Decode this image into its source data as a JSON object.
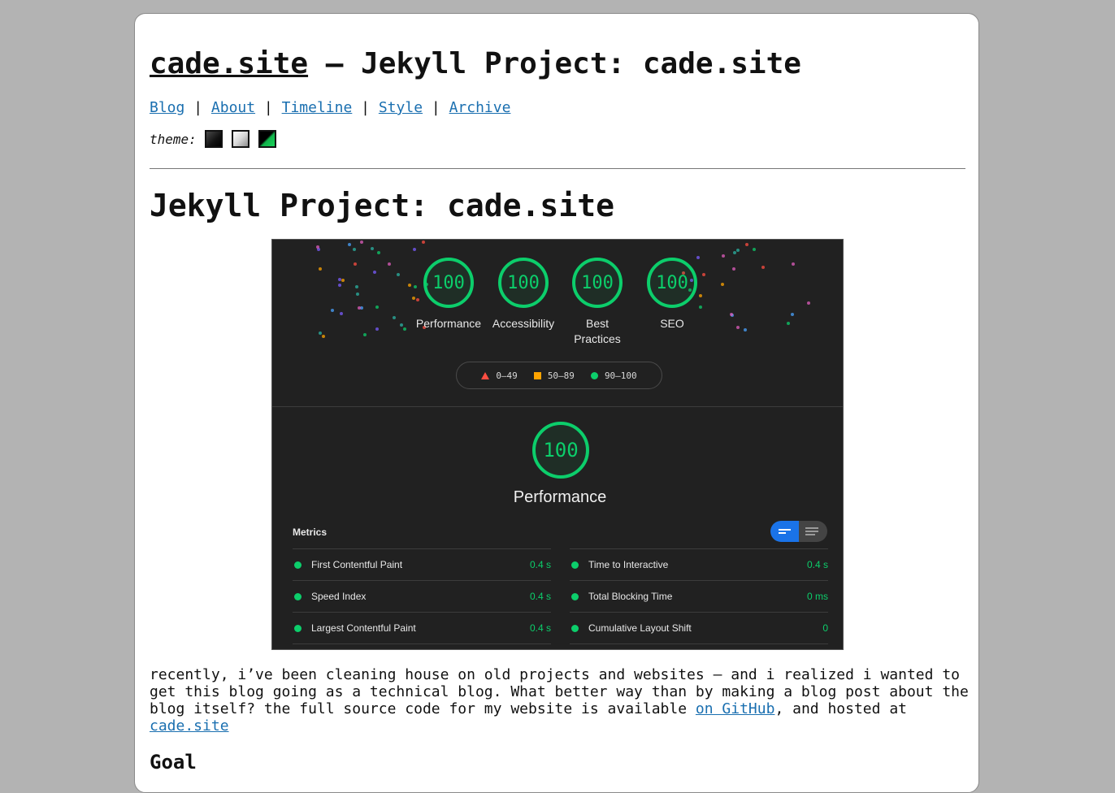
{
  "site": {
    "name": "cade.site",
    "title_suffix": " — Jekyll Project: cade.site"
  },
  "nav": {
    "items": [
      "Blog",
      "About",
      "Timeline",
      "Style",
      "Archive"
    ],
    "separator": "|"
  },
  "theme": {
    "label": "theme:",
    "swatches": [
      "dark",
      "light",
      "green"
    ]
  },
  "post": {
    "title": "Jekyll Project: cade.site",
    "intro_before_link1": "recently, i’ve been cleaning house on old projects and websites — and i realized i wanted to get this blog going as a technical blog. What better way than by making a blog post about the blog itself? the full source code for my website is available ",
    "link1": "on GitHub",
    "intro_between": ", and hosted at ",
    "link2": "cade.site",
    "goal_heading": "Goal"
  },
  "lighthouse": {
    "scores": [
      {
        "label": "Performance",
        "value": "100"
      },
      {
        "label": "Accessibility",
        "value": "100"
      },
      {
        "label": "Best Practices",
        "value": "100"
      },
      {
        "label": "SEO",
        "value": "100"
      }
    ],
    "legend": [
      "0–49",
      "50–89",
      "90–100"
    ],
    "main_score": "100",
    "main_label": "Performance",
    "metrics_title": "Metrics",
    "metrics_left": [
      {
        "name": "First Contentful Paint",
        "value": "0.4 s"
      },
      {
        "name": "Speed Index",
        "value": "0.4 s"
      },
      {
        "name": "Largest Contentful Paint",
        "value": "0.4 s"
      }
    ],
    "metrics_right": [
      {
        "name": "Time to Interactive",
        "value": "0.4 s"
      },
      {
        "name": "Total Blocking Time",
        "value": "0 ms"
      },
      {
        "name": "Cumulative Layout Shift",
        "value": "0"
      }
    ],
    "colors": {
      "pass": "#0cce6b",
      "average": "#ffa400",
      "fail": "#ff4e42"
    }
  }
}
